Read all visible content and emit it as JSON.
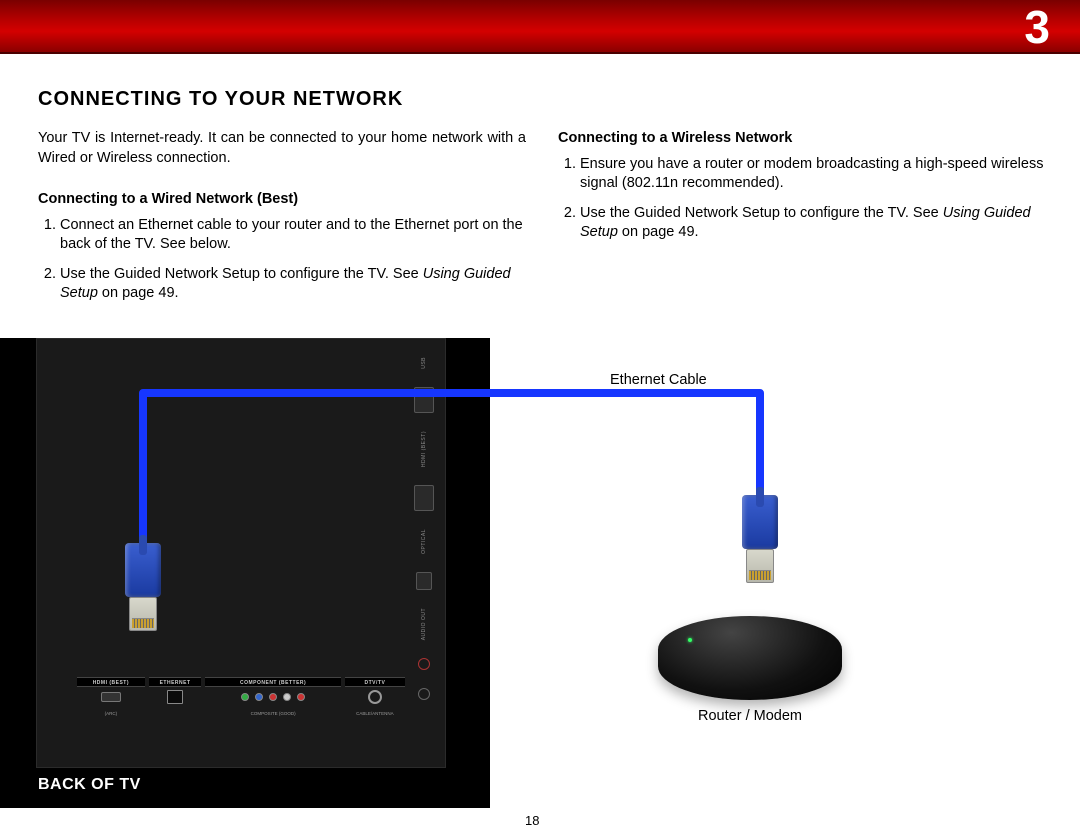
{
  "header": {
    "page_number": "3"
  },
  "section": {
    "title": "CONNECTING TO YOUR NETWORK",
    "intro": "Your TV is Internet-ready. It can be connected to your home network with a Wired or Wireless connection."
  },
  "wired": {
    "heading": "Connecting to a Wired Network (Best)",
    "step1": "Connect an Ethernet cable to your router and to the Ethernet port on the back of the TV. See below.",
    "step2_a": "Use the Guided Network Setup to configure the TV. See ",
    "step2_italic": "Using Guided Setup",
    "step2_b": " on page 49."
  },
  "wireless": {
    "heading": "Connecting to a Wireless Network",
    "step1": "Ensure you have a router or modem broadcasting a high-speed wireless signal (802.11n recommended).",
    "step2_a": "Use the Guided Network Setup to configure the TV. See ",
    "step2_italic": "Using Guided Setup",
    "step2_b": " on page 49."
  },
  "diagram": {
    "ethernet_cable_label": "Ethernet Cable",
    "router_label": "Router / Modem",
    "back_of_tv": "BACK OF TV",
    "port_labels": {
      "hdmi": "HDMI (BEST)",
      "ethernet": "ETHERNET",
      "component": "COMPONENT (BETTER)",
      "dtv": "DTV/TV",
      "arc": "(ARC)",
      "composite": "COMPOSITE (GOOD)",
      "cable": "CABLE/ANTENNA",
      "usb": "USB",
      "hdmi_side": "HDMI (BEST)",
      "optical": "OPTICAL",
      "audio_out": "AUDIO OUT"
    }
  },
  "footer": {
    "page": "18"
  },
  "colors": {
    "cable_blue": "#1636ff",
    "header_red": "#b90000"
  }
}
